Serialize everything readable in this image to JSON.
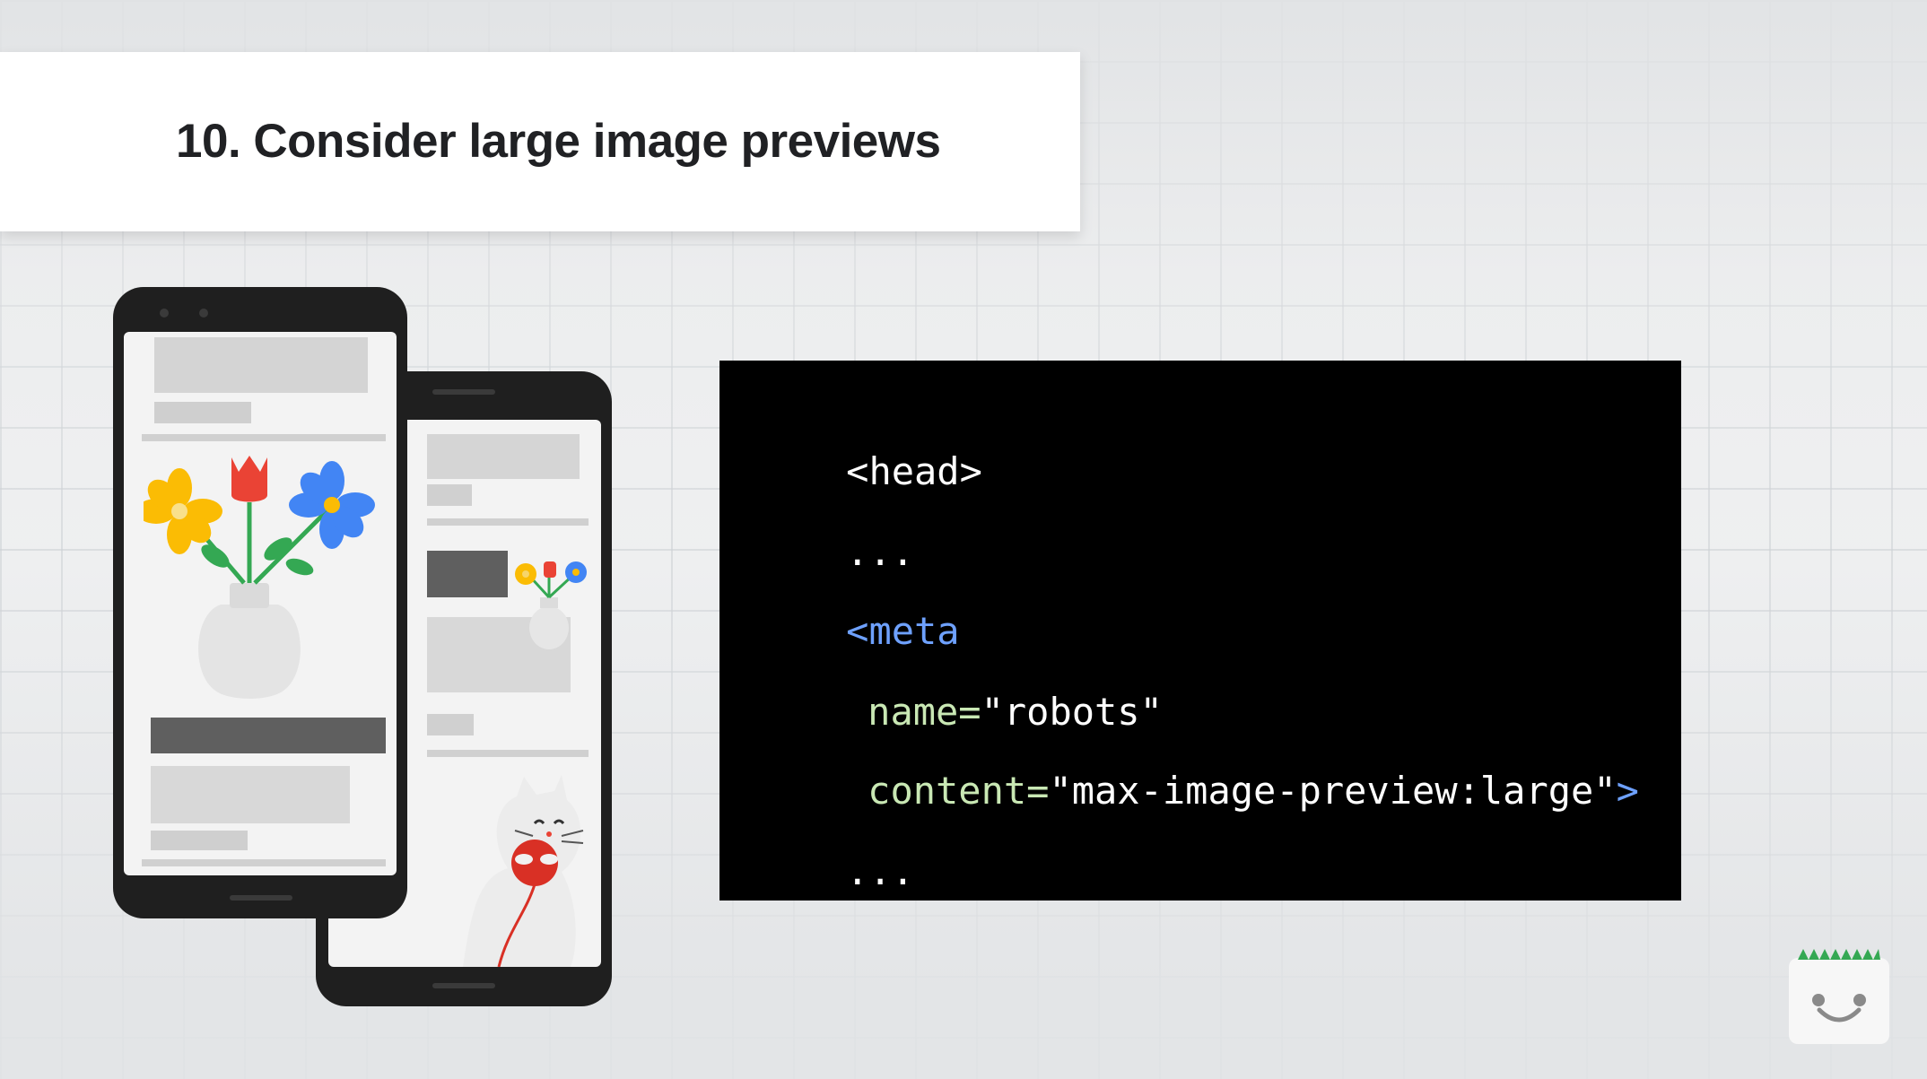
{
  "slide": {
    "title": "10.  Consider large image previews"
  },
  "code": {
    "line1": "<head>",
    "line2": "...",
    "line3": "<meta",
    "line4_attr": "name=",
    "line4_value": "\"robots\"",
    "line5_attr": "content=",
    "line5_value": "\"max-image-preview:large\"",
    "line5_close": ">",
    "line6": "..."
  },
  "colors": {
    "code_background": "#000000",
    "attribute_green": "#c9e8b4",
    "tag_blue": "#6ea1ff",
    "title_text": "#202124"
  },
  "illustrations": {
    "phone_large": "phone-flower-vase-illustration",
    "phone_small": "phone-cat-yarn-illustration",
    "mascot": "smiley-mascot-icon"
  }
}
